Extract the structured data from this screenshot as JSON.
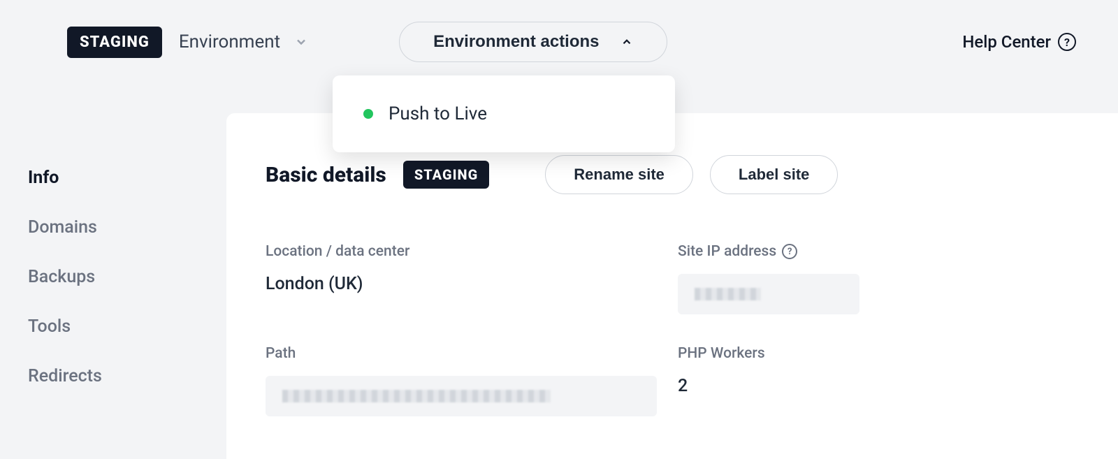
{
  "topbar": {
    "staging_badge": "STAGING",
    "environment_label": "Environment",
    "actions_button": "Environment actions",
    "help_center": "Help Center"
  },
  "dropdown": {
    "items": [
      {
        "label": "Push to Live",
        "status_color": "#22c55e"
      }
    ]
  },
  "sidebar": {
    "items": [
      {
        "label": "Info",
        "active": true
      },
      {
        "label": "Domains",
        "active": false
      },
      {
        "label": "Backups",
        "active": false
      },
      {
        "label": "Tools",
        "active": false
      },
      {
        "label": "Redirects",
        "active": false
      }
    ]
  },
  "main": {
    "section_title": "Basic details",
    "section_badge": "STAGING",
    "buttons": {
      "rename": "Rename site",
      "label_site": "Label site"
    },
    "fields": {
      "location_label": "Location / data center",
      "location_value": "London (UK)",
      "ip_label": "Site IP address",
      "ip_value_redacted": true,
      "path_label": "Path",
      "path_value_redacted": true,
      "php_workers_label": "PHP Workers",
      "php_workers_value": "2"
    }
  }
}
